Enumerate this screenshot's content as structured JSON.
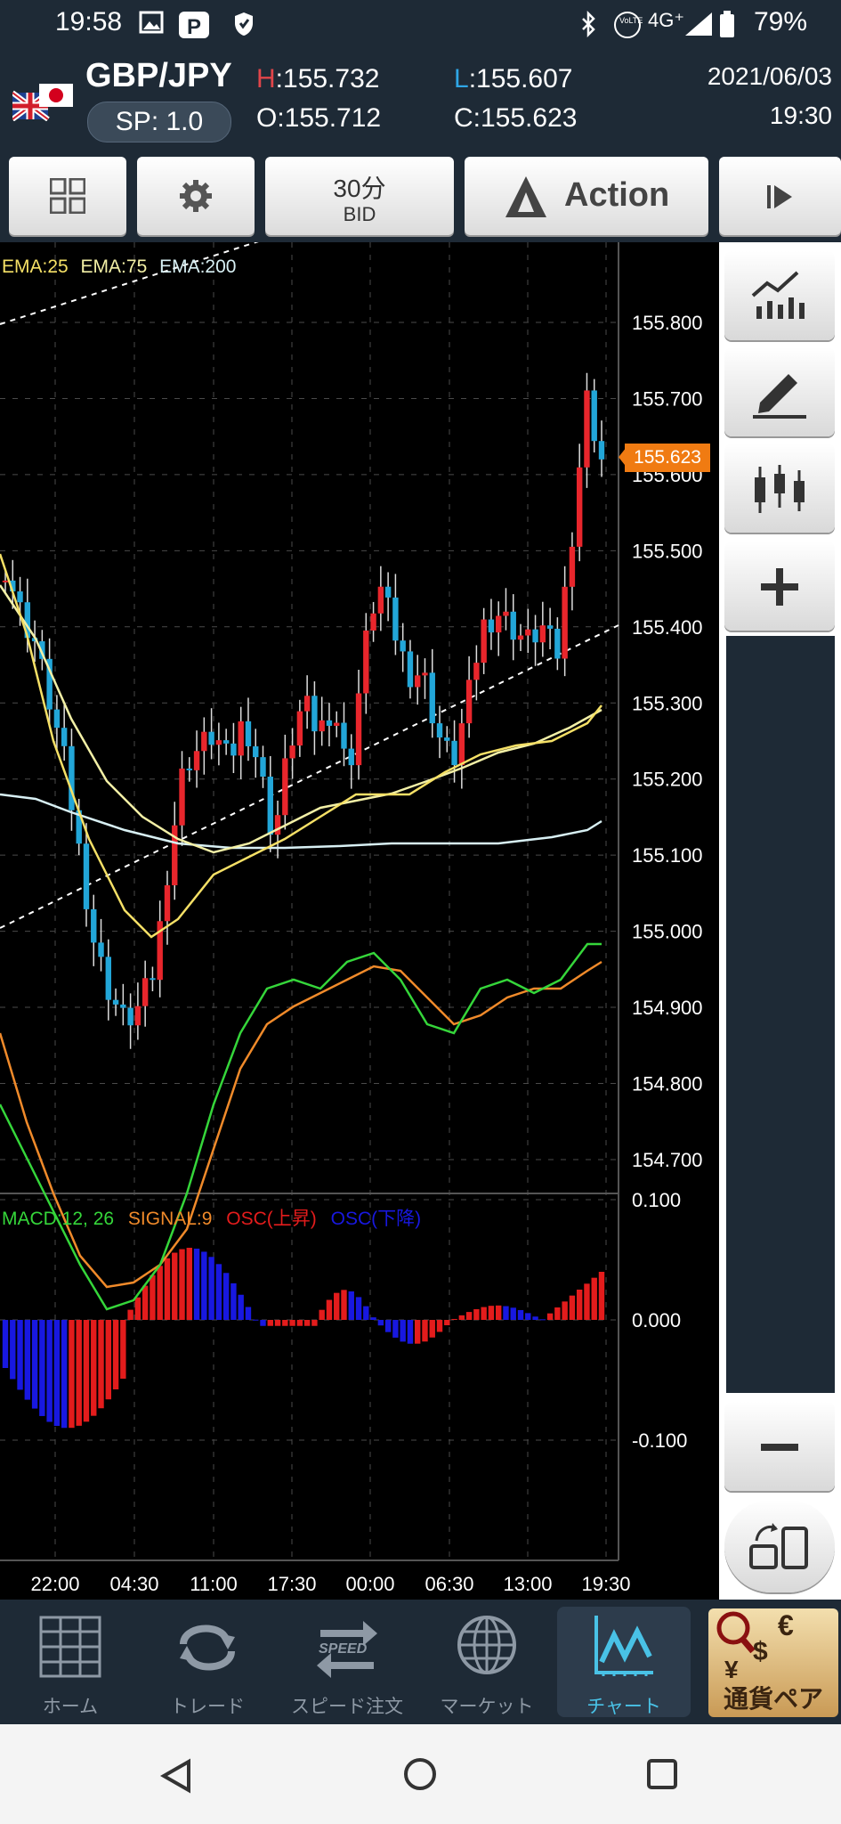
{
  "status_bar": {
    "time": "19:58",
    "network": "4G⁺",
    "battery": "79%"
  },
  "header": {
    "pair": "GBP/JPY",
    "spread": "SP: 1.0",
    "high_label": "H",
    "high_value": ":155.732",
    "low_label": "L",
    "low_value": ":155.607",
    "open": "O:155.712",
    "close": "C:155.623",
    "date": "2021/06/03",
    "time": "19:30"
  },
  "toolbar": {
    "timeframe": "30分",
    "price_type": "BID",
    "action_label": "Action"
  },
  "chart": {
    "indicators": [
      "EMA:25",
      "EMA:75",
      "EMA:200"
    ],
    "current_price": "155.623",
    "price_ticks": [
      "155.800",
      "155.700",
      "155.600",
      "155.500",
      "155.400",
      "155.300",
      "155.200",
      "155.100",
      "155.000",
      "154.900",
      "154.800",
      "154.700"
    ],
    "macd_legend": {
      "macd": "MACD:12, 26",
      "signal": "SIGNAL:9",
      "osc_up": "OSC(上昇)",
      "osc_down": "OSC(下降)"
    },
    "macd_ticks": [
      "0.100",
      "0.000",
      "-0.100"
    ],
    "time_ticks": [
      "22:00",
      "04:30",
      "11:00",
      "17:30",
      "00:00",
      "06:30",
      "13:00",
      "19:30"
    ],
    "colors": {
      "bull": "#e8262c",
      "bear": "#22a6d8",
      "ema25": "#f5e066",
      "ema75": "#f3f0a6",
      "ema200": "#d8f0f4",
      "macd": "#35d63a",
      "signal": "#f08a2a",
      "osc_up": "#e31c1c",
      "osc_down": "#1818e0",
      "price_tag": "#f07b12"
    }
  },
  "nav": {
    "items": [
      {
        "label": "ホーム",
        "icon": "grid-icon"
      },
      {
        "label": "トレード",
        "icon": "cycle-icon"
      },
      {
        "label": "スピード注文",
        "icon": "speed-icon"
      },
      {
        "label": "マーケット",
        "icon": "globe-icon"
      },
      {
        "label": "チャート",
        "icon": "chart-icon"
      },
      {
        "label": "通貨ペア",
        "icon": "currency-pair-icon"
      }
    ],
    "speed_badge": "SPEED",
    "pair_symbols": [
      "€",
      "$",
      "¥"
    ]
  }
}
